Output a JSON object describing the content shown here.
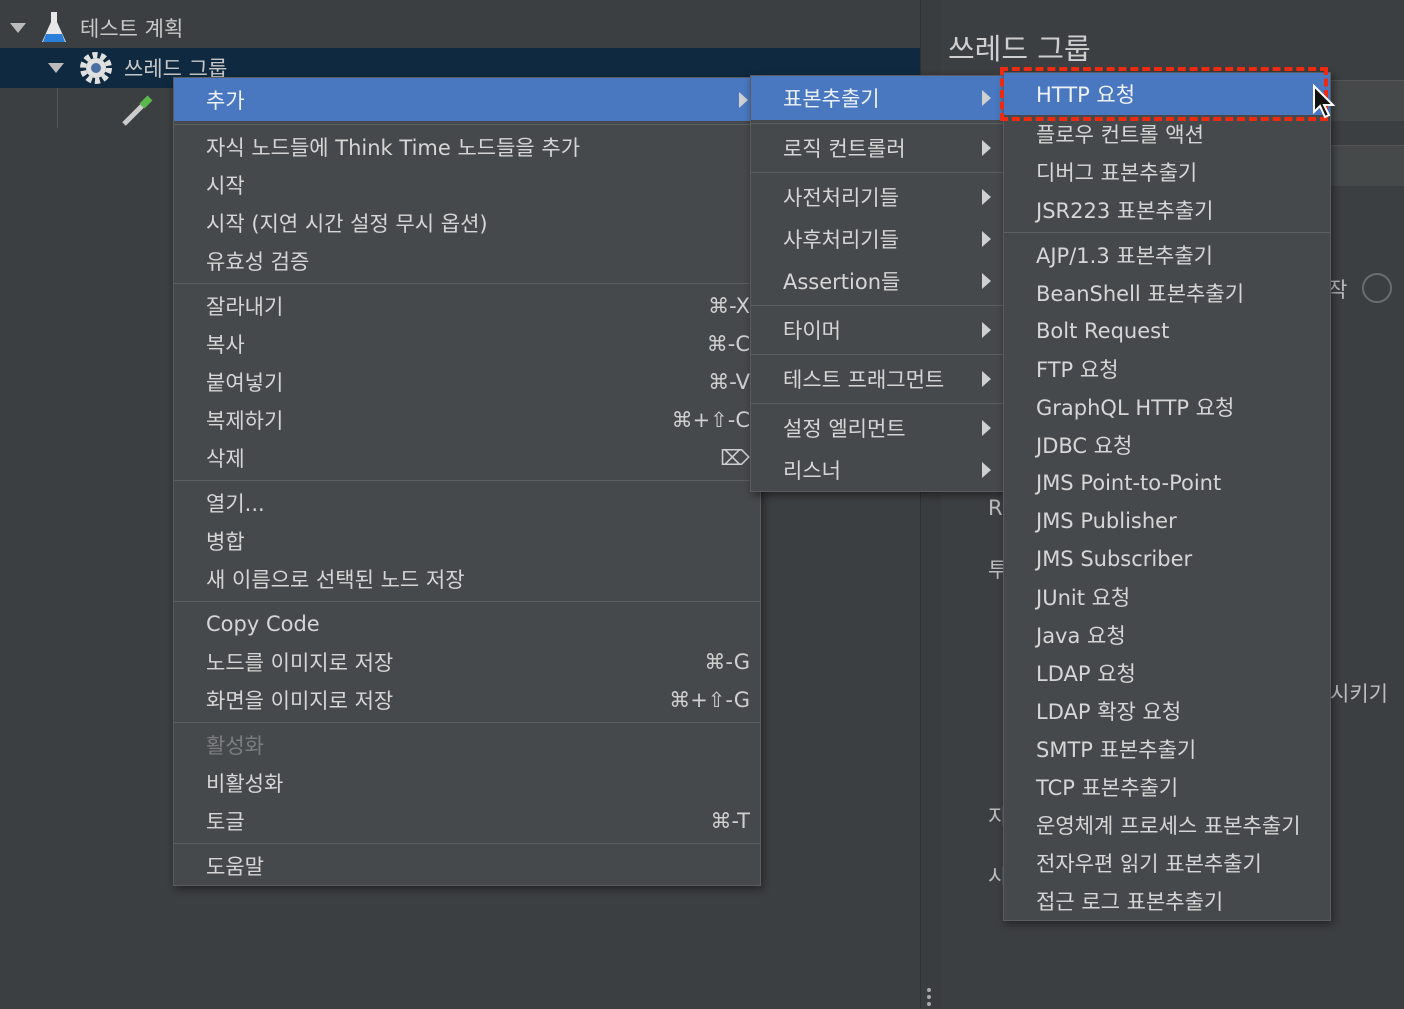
{
  "tree": {
    "items": [
      {
        "label": "테스트 계획",
        "icon": "flask-icon"
      },
      {
        "label": "쓰레드 그룹",
        "icon": "gear-icon"
      },
      {
        "label": "",
        "icon": "pipette-icon"
      }
    ]
  },
  "right_panel": {
    "title": "쓰레드 그룹",
    "fragments": [
      "작",
      "시키기",
      "R",
      "투",
      "지",
      "시"
    ]
  },
  "context_menu": {
    "groups": [
      [
        {
          "label": "추가",
          "submenu": true,
          "highlighted": true
        }
      ],
      [
        {
          "label": "자식 노드들에 Think Time 노드들을 추가"
        },
        {
          "label": "시작"
        },
        {
          "label": "시작 (지연 시간 설정 무시 옵션)"
        },
        {
          "label": "유효성 검증"
        }
      ],
      [
        {
          "label": "잘라내기",
          "shortcut": "⌘-X"
        },
        {
          "label": "복사",
          "shortcut": "⌘-C"
        },
        {
          "label": "붙여넣기",
          "shortcut": "⌘-V"
        },
        {
          "label": "복제하기",
          "shortcut": "⌘+⇧-C"
        },
        {
          "label": "삭제",
          "shortcut": "⌦"
        }
      ],
      [
        {
          "label": "열기..."
        },
        {
          "label": "병합"
        },
        {
          "label": "새 이름으로 선택된 노드 저장"
        }
      ],
      [
        {
          "label": "Copy Code"
        },
        {
          "label": "노드를 이미지로 저장",
          "shortcut": "⌘-G"
        },
        {
          "label": "화면을 이미지로 저장",
          "shortcut": "⌘+⇧-G"
        }
      ],
      [
        {
          "label": "활성화",
          "disabled": true
        },
        {
          "label": "비활성화"
        },
        {
          "label": "토글",
          "shortcut": "⌘-T"
        }
      ],
      [
        {
          "label": "도움말"
        }
      ]
    ]
  },
  "add_submenu": {
    "groups": [
      [
        {
          "label": "표본추출기",
          "submenu": true,
          "highlighted": true
        }
      ],
      [
        {
          "label": "로직 컨트롤러",
          "submenu": true
        }
      ],
      [
        {
          "label": "사전처리기들",
          "submenu": true
        },
        {
          "label": "사후처리기들",
          "submenu": true
        },
        {
          "label": "Assertion들",
          "submenu": true
        }
      ],
      [
        {
          "label": "타이머",
          "submenu": true
        }
      ],
      [
        {
          "label": "테스트 프래그먼트",
          "submenu": true
        }
      ],
      [
        {
          "label": "설정 엘리먼트",
          "submenu": true
        },
        {
          "label": "리스너",
          "submenu": true
        }
      ]
    ]
  },
  "sampler_submenu": {
    "groups": [
      [
        {
          "label": "HTTP 요청",
          "highlighted": true
        },
        {
          "label": "플로우 컨트롤 액션"
        },
        {
          "label": "디버그 표본추출기"
        },
        {
          "label": "JSR223 표본추출기"
        }
      ],
      [
        {
          "label": "AJP/1.3 표본추출기"
        },
        {
          "label": "BeanShell 표본추출기"
        },
        {
          "label": "Bolt Request"
        },
        {
          "label": "FTP 요청"
        },
        {
          "label": "GraphQL HTTP 요청"
        },
        {
          "label": "JDBC 요청"
        },
        {
          "label": "JMS Point-to-Point"
        },
        {
          "label": "JMS Publisher"
        },
        {
          "label": "JMS Subscriber"
        },
        {
          "label": "JUnit 요청"
        },
        {
          "label": "Java 요청"
        },
        {
          "label": "LDAP 요청"
        },
        {
          "label": "LDAP 확장 요청"
        },
        {
          "label": "SMTP 표본추출기"
        },
        {
          "label": "TCP 표본추출기"
        },
        {
          "label": "운영체계 프로세스 표본추출기"
        },
        {
          "label": "전자우편 읽기 표본추출기"
        },
        {
          "label": "접근 로그 표본추출기"
        }
      ]
    ]
  },
  "colors": {
    "highlight": "#4a78c0",
    "annotation": "#ee2a10",
    "selected_row": "#0f2a40"
  }
}
